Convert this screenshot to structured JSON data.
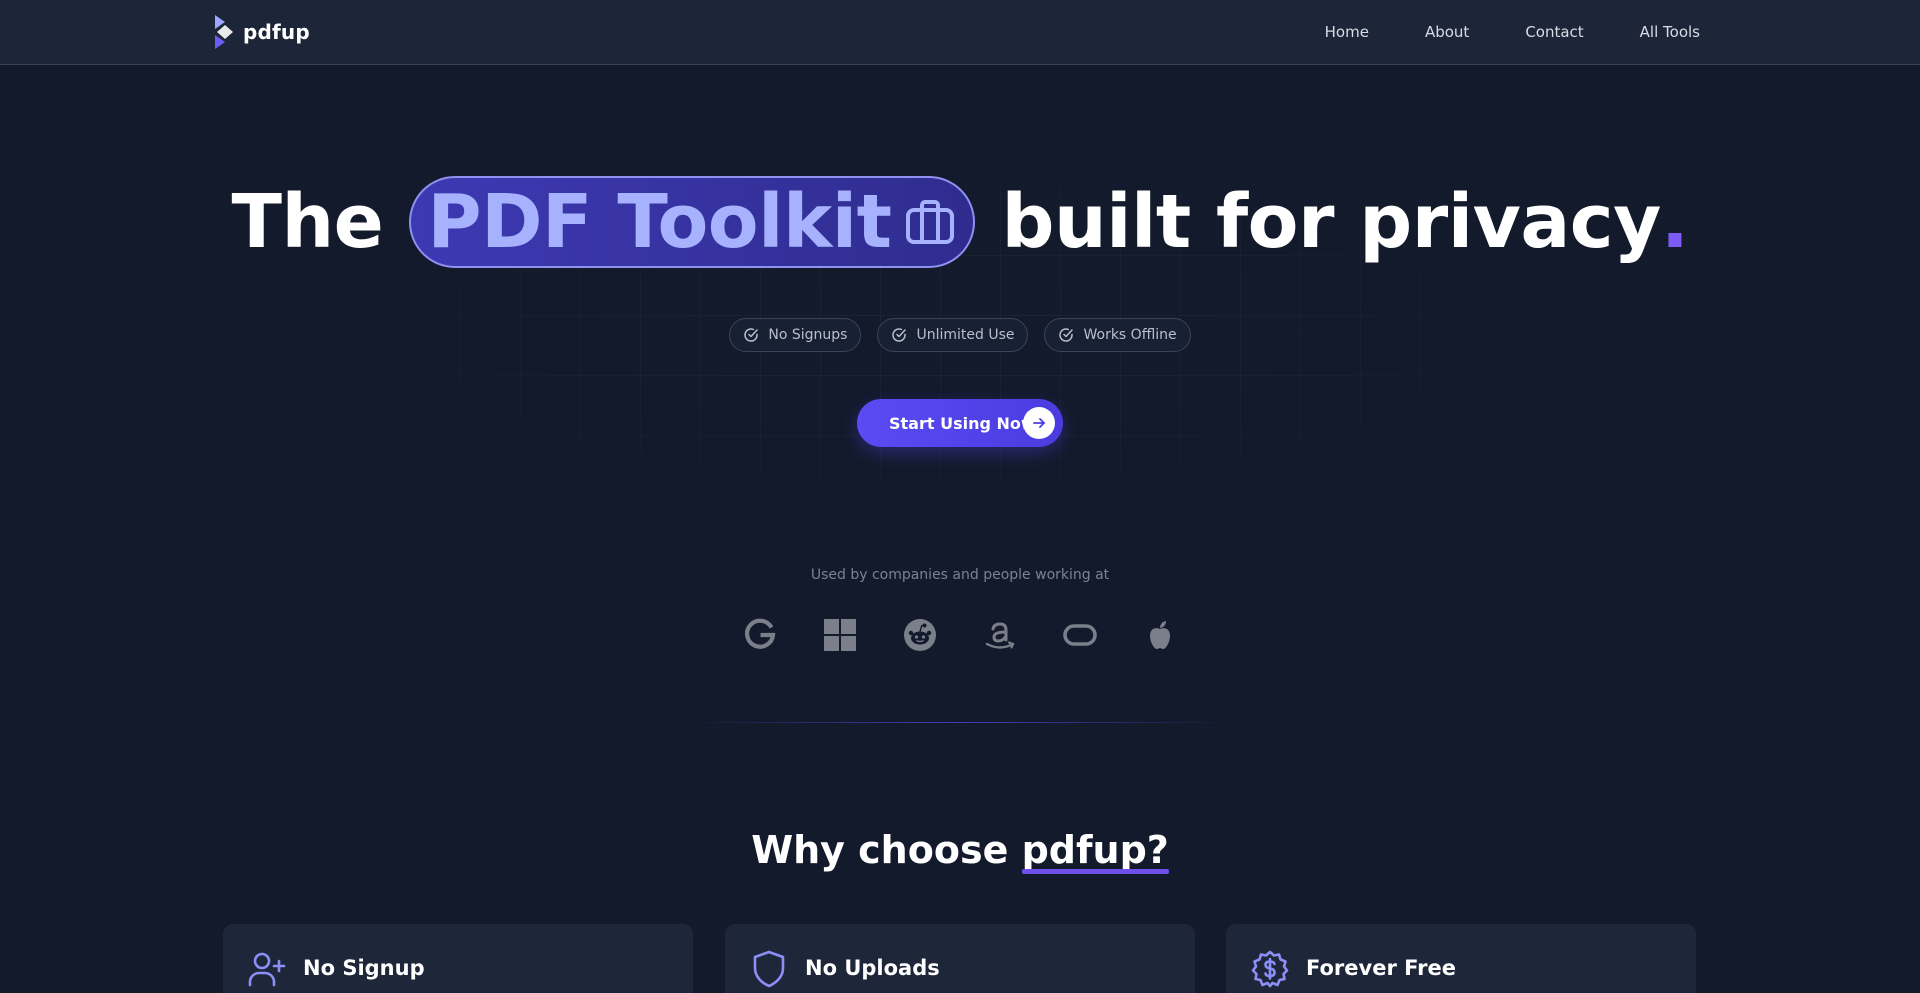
{
  "header": {
    "brand": "pdfup",
    "nav": [
      "Home",
      "About",
      "Contact",
      "All Tools"
    ]
  },
  "hero": {
    "title_before": "The",
    "title_highlight": "PDF Toolkit",
    "title_after": "built for privacy",
    "title_dot": ".",
    "badges": [
      "No Signups",
      "Unlimited Use",
      "Works Offline"
    ],
    "cta_label": "Start Using Now"
  },
  "trust": {
    "caption": "Used by companies and people working at",
    "logos": [
      "google-icon",
      "windows-icon",
      "reddit-icon",
      "amazon-icon",
      "oculus-icon",
      "apple-icon"
    ]
  },
  "why": {
    "title_prefix": "Why choose",
    "title_brand": "pdfup?",
    "cards": [
      {
        "title": "No Signup",
        "icon": "user-plus-icon"
      },
      {
        "title": "No Uploads",
        "icon": "shield-icon"
      },
      {
        "title": "Forever Free",
        "icon": "dollar-badge-icon"
      }
    ]
  },
  "colors": {
    "background": "#131a2b",
    "header": "#1d2638",
    "accent": "#5a4bf5",
    "accent_light": "#a7b2ff",
    "card": "#1e2739"
  }
}
